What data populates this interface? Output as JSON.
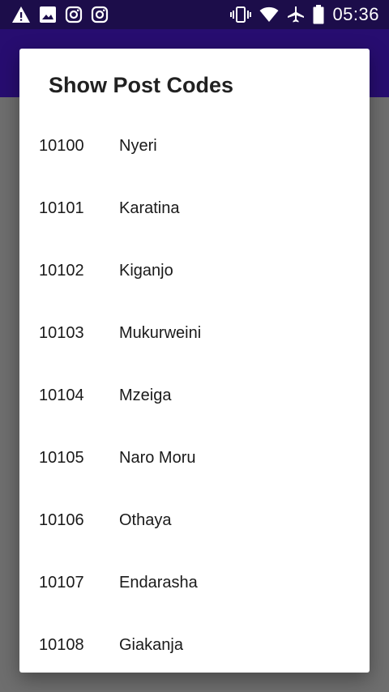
{
  "status_bar": {
    "time": "05:36",
    "left_icons": [
      "warning-icon",
      "image-icon",
      "instagram-icon",
      "instagram-icon"
    ],
    "right_icons": [
      "vibrate-icon",
      "wifi-icon",
      "airplane-icon",
      "battery-icon"
    ]
  },
  "dialog": {
    "title": "Show Post Codes",
    "items": [
      {
        "code": "10100",
        "town": "Nyeri"
      },
      {
        "code": "10101",
        "town": "Karatina"
      },
      {
        "code": "10102",
        "town": "Kiganjo"
      },
      {
        "code": "10103",
        "town": "Mukurweini"
      },
      {
        "code": "10104",
        "town": "Mzeiga"
      },
      {
        "code": "10105",
        "town": "Naro Moru"
      },
      {
        "code": "10106",
        "town": "Othaya"
      },
      {
        "code": "10107",
        "town": "Endarasha"
      },
      {
        "code": "10108",
        "town": "Giakanja"
      }
    ]
  },
  "colors": {
    "status_bar": "#1c0d4a",
    "app_bar": "#270d70",
    "scrim": "#6e6e6e",
    "dialog": "#ffffff"
  }
}
